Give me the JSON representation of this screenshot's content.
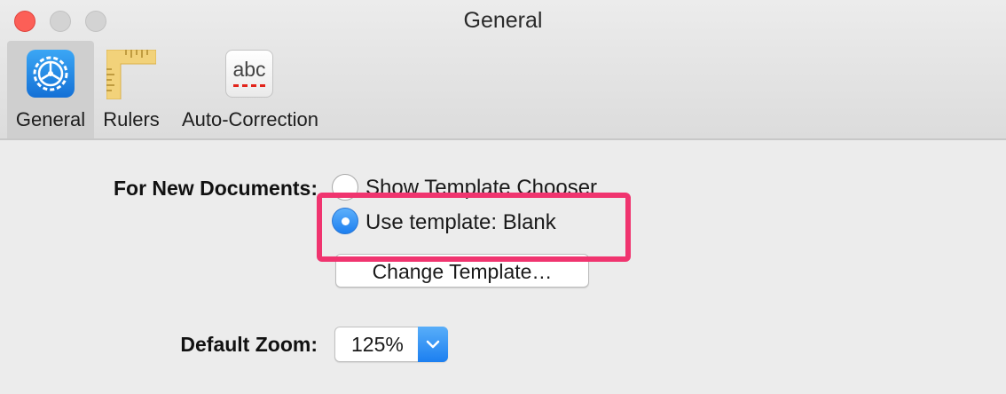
{
  "window": {
    "title": "General"
  },
  "toolbar": {
    "tabs": [
      {
        "label": "General",
        "icon": "gear-icon",
        "selected": true
      },
      {
        "label": "Rulers",
        "icon": "ruler-icon",
        "selected": false
      },
      {
        "label": "Auto-Correction",
        "icon": "abc-spellcheck-icon",
        "selected": false
      }
    ],
    "abc_icon_text": "abc"
  },
  "new_documents": {
    "label": "For New Documents:",
    "options": [
      {
        "label": "Show Template Chooser",
        "selected": false
      },
      {
        "label": "Use template: Blank",
        "selected": true
      }
    ],
    "change_button_label": "Change Template…"
  },
  "zoom": {
    "label": "Default Zoom:",
    "value": "125%"
  },
  "colors": {
    "accent": "#1d7ff0",
    "highlight": "#f0346f",
    "close": "#fc5f57"
  }
}
